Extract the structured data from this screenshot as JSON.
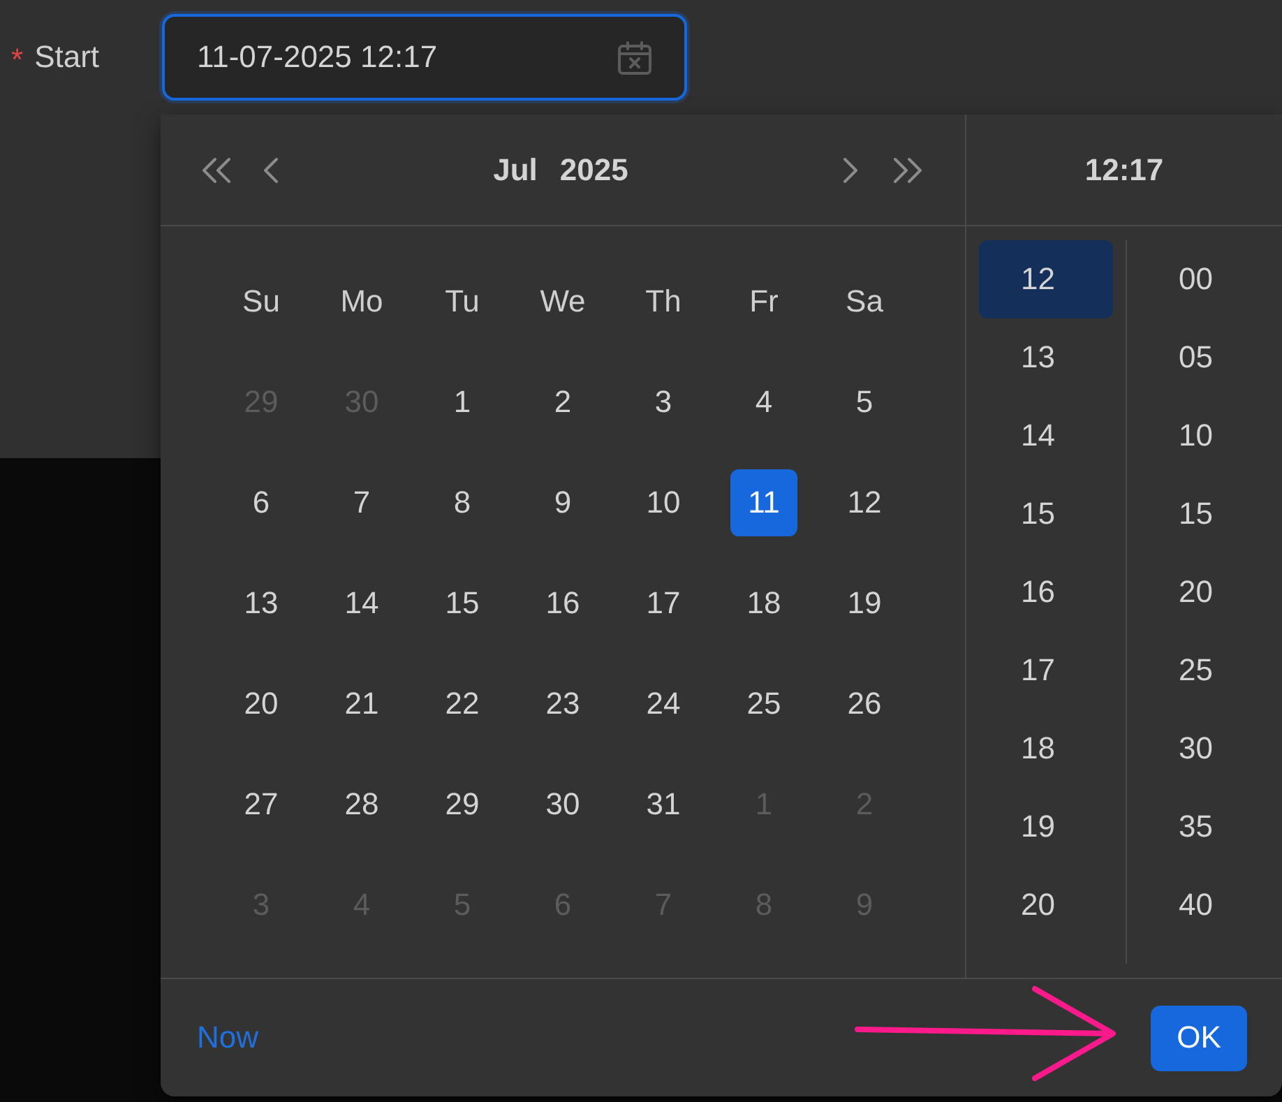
{
  "form": {
    "required_mark": "*",
    "label": "Start",
    "input": {
      "value": "11-07-2025 12:17",
      "focused": true
    }
  },
  "picker": {
    "header": {
      "month": "Jul",
      "year": "2025"
    },
    "time_header": "12:17",
    "weekdays": [
      "Su",
      "Mo",
      "Tu",
      "We",
      "Th",
      "Fr",
      "Sa"
    ],
    "weeks": [
      [
        {
          "label": "29",
          "outside_month": true,
          "selected": false
        },
        {
          "label": "30",
          "outside_month": true,
          "selected": false
        },
        {
          "label": "1",
          "outside_month": false,
          "selected": false
        },
        {
          "label": "2",
          "outside_month": false,
          "selected": false
        },
        {
          "label": "3",
          "outside_month": false,
          "selected": false
        },
        {
          "label": "4",
          "outside_month": false,
          "selected": false
        },
        {
          "label": "5",
          "outside_month": false,
          "selected": false
        }
      ],
      [
        {
          "label": "6",
          "outside_month": false,
          "selected": false
        },
        {
          "label": "7",
          "outside_month": false,
          "selected": false
        },
        {
          "label": "8",
          "outside_month": false,
          "selected": false
        },
        {
          "label": "9",
          "outside_month": false,
          "selected": false
        },
        {
          "label": "10",
          "outside_month": false,
          "selected": false
        },
        {
          "label": "11",
          "outside_month": false,
          "selected": true
        },
        {
          "label": "12",
          "outside_month": false,
          "selected": false
        }
      ],
      [
        {
          "label": "13",
          "outside_month": false,
          "selected": false
        },
        {
          "label": "14",
          "outside_month": false,
          "selected": false
        },
        {
          "label": "15",
          "outside_month": false,
          "selected": false
        },
        {
          "label": "16",
          "outside_month": false,
          "selected": false
        },
        {
          "label": "17",
          "outside_month": false,
          "selected": false
        },
        {
          "label": "18",
          "outside_month": false,
          "selected": false
        },
        {
          "label": "19",
          "outside_month": false,
          "selected": false
        }
      ],
      [
        {
          "label": "20",
          "outside_month": false,
          "selected": false
        },
        {
          "label": "21",
          "outside_month": false,
          "selected": false
        },
        {
          "label": "22",
          "outside_month": false,
          "selected": false
        },
        {
          "label": "23",
          "outside_month": false,
          "selected": false
        },
        {
          "label": "24",
          "outside_month": false,
          "selected": false
        },
        {
          "label": "25",
          "outside_month": false,
          "selected": false
        },
        {
          "label": "26",
          "outside_month": false,
          "selected": false
        }
      ],
      [
        {
          "label": "27",
          "outside_month": false,
          "selected": false
        },
        {
          "label": "28",
          "outside_month": false,
          "selected": false
        },
        {
          "label": "29",
          "outside_month": false,
          "selected": false
        },
        {
          "label": "30",
          "outside_month": false,
          "selected": false
        },
        {
          "label": "31",
          "outside_month": false,
          "selected": false
        },
        {
          "label": "1",
          "outside_month": true,
          "selected": false
        },
        {
          "label": "2",
          "outside_month": true,
          "selected": false
        }
      ],
      [
        {
          "label": "3",
          "outside_month": true,
          "selected": false
        },
        {
          "label": "4",
          "outside_month": true,
          "selected": false
        },
        {
          "label": "5",
          "outside_month": true,
          "selected": false
        },
        {
          "label": "6",
          "outside_month": true,
          "selected": false
        },
        {
          "label": "7",
          "outside_month": true,
          "selected": false
        },
        {
          "label": "8",
          "outside_month": true,
          "selected": false
        },
        {
          "label": "9",
          "outside_month": true,
          "selected": false
        }
      ]
    ],
    "hours": [
      {
        "label": "12",
        "selected": true
      },
      {
        "label": "13",
        "selected": false
      },
      {
        "label": "14",
        "selected": false
      },
      {
        "label": "15",
        "selected": false
      },
      {
        "label": "16",
        "selected": false
      },
      {
        "label": "17",
        "selected": false
      },
      {
        "label": "18",
        "selected": false
      },
      {
        "label": "19",
        "selected": false
      },
      {
        "label": "20",
        "selected": false
      }
    ],
    "minutes": [
      {
        "label": "00",
        "selected": false
      },
      {
        "label": "05",
        "selected": false
      },
      {
        "label": "10",
        "selected": false
      },
      {
        "label": "15",
        "selected": false
      },
      {
        "label": "20",
        "selected": false
      },
      {
        "label": "25",
        "selected": false
      },
      {
        "label": "30",
        "selected": false
      },
      {
        "label": "35",
        "selected": false
      },
      {
        "label": "40",
        "selected": false
      }
    ],
    "footer": {
      "now_link": "Now",
      "ok_button": "OK"
    }
  }
}
